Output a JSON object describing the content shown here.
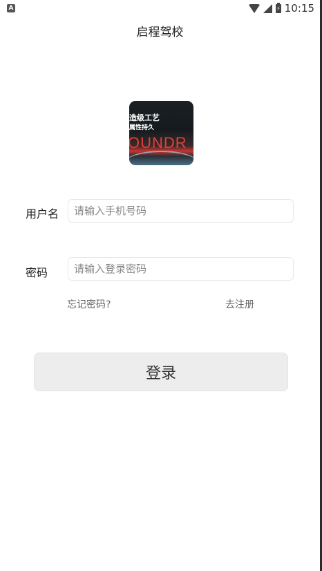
{
  "status_bar": {
    "left_icon": "A",
    "time": "10:15",
    "icons": [
      "wifi-icon",
      "signal-icon",
      "battery-icon"
    ]
  },
  "header": {
    "title": "启程驾校"
  },
  "logo": {
    "line1": "造级工艺",
    "line2": "属性持久",
    "big_text": "OUNDR"
  },
  "form": {
    "username": {
      "label": "用户名",
      "value": "",
      "placeholder": "请输入手机号码"
    },
    "password": {
      "label": "密码",
      "value": "",
      "placeholder": "请输入登录密码"
    },
    "forgot_password": "忘记密码?",
    "register": "去注册",
    "login_button": "登录"
  },
  "colors": {
    "background": "#ffffff",
    "button_bg": "#ededed",
    "input_border": "#e8e8e8",
    "link_text": "#666666"
  }
}
